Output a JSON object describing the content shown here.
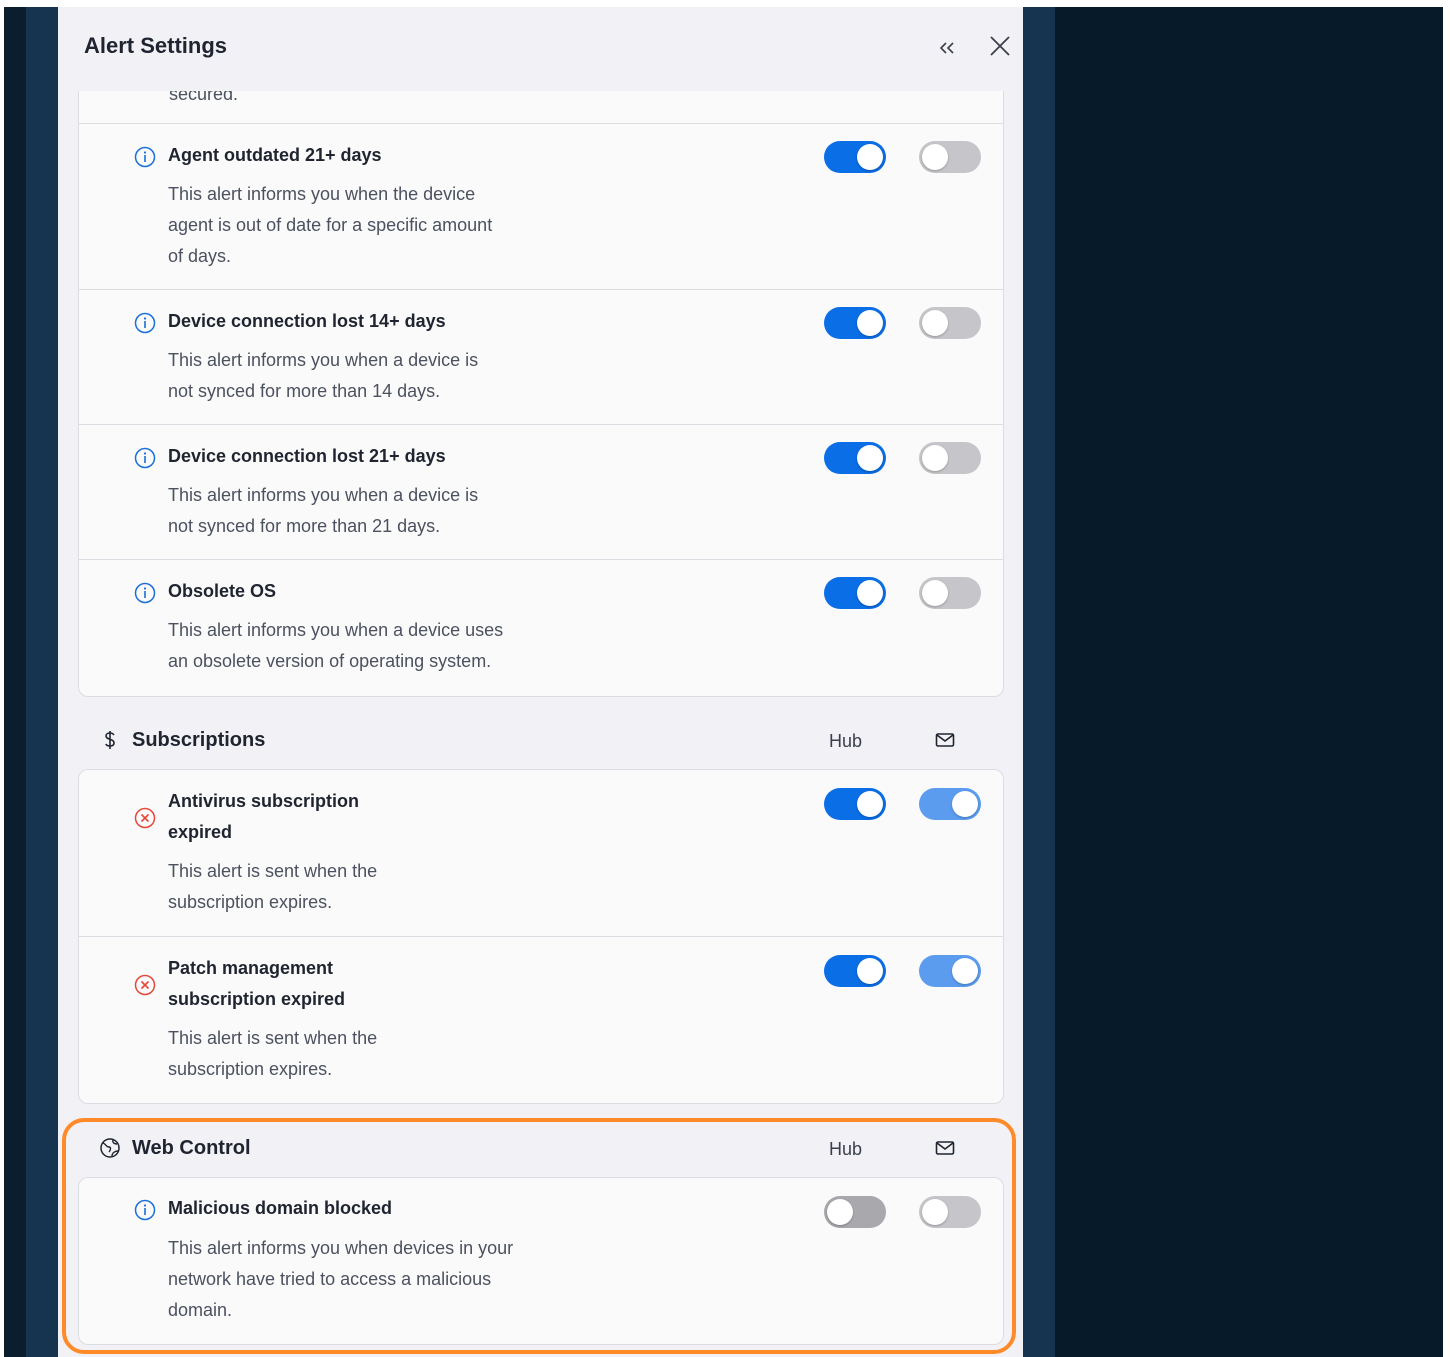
{
  "panel": {
    "title": "Alert Settings"
  },
  "partial_text": "secured.",
  "device_alerts": [
    {
      "title": "Agent outdated 21+ days",
      "desc_lines": [
        "This alert informs you when the device",
        "agent is out of date for a specific amount",
        "of days."
      ],
      "icon": "info-icon",
      "hub": "on",
      "email": "off"
    },
    {
      "title": "Device connection lost 14+ days",
      "desc_lines": [
        "This alert informs you when a device is",
        "not synced for more than 14 days."
      ],
      "icon": "info-icon",
      "hub": "on",
      "email": "off"
    },
    {
      "title": "Device connection lost 21+ days",
      "desc_lines": [
        "This alert informs you when a device is",
        "not synced for more than 21 days."
      ],
      "icon": "info-icon",
      "hub": "on",
      "email": "off"
    },
    {
      "title": "Obsolete OS",
      "desc_lines": [
        "This alert informs you when a device uses",
        "an obsolete version of operating system."
      ],
      "icon": "info-icon",
      "hub": "on",
      "email": "off"
    }
  ],
  "subscriptions": {
    "title": "Subscriptions",
    "icon": "dollar-icon",
    "hub_label": "Hub",
    "alerts": [
      {
        "title_lines": [
          "Antivirus subscription",
          "expired"
        ],
        "desc_lines": [
          "This alert is sent when the",
          "subscription expires."
        ],
        "icon": "error-circle-icon",
        "hub": "on",
        "email": "on"
      },
      {
        "title_lines": [
          "Patch management",
          "subscription expired"
        ],
        "desc_lines": [
          "This alert is sent when the",
          "subscription expires."
        ],
        "icon": "error-circle-icon",
        "hub": "on",
        "email": "on"
      }
    ]
  },
  "web_control": {
    "title": "Web Control",
    "icon": "globe-icon",
    "hub_label": "Hub",
    "alerts": [
      {
        "title": "Malicious domain blocked",
        "desc_lines": [
          "This alert informs you when devices in your",
          "network have tried to access a malicious",
          "domain."
        ],
        "icon": "info-icon",
        "hub": "off",
        "email": "off"
      }
    ]
  },
  "colors": {
    "toggle_on": "#0a6ee6",
    "toggle_on_light": "#5b9cef",
    "toggle_off": "#c6c6ca",
    "info_icon": "#1a6fd8",
    "error_icon": "#e5483b",
    "highlight": "#ff8a2a",
    "backdrop": "#061a2a"
  }
}
